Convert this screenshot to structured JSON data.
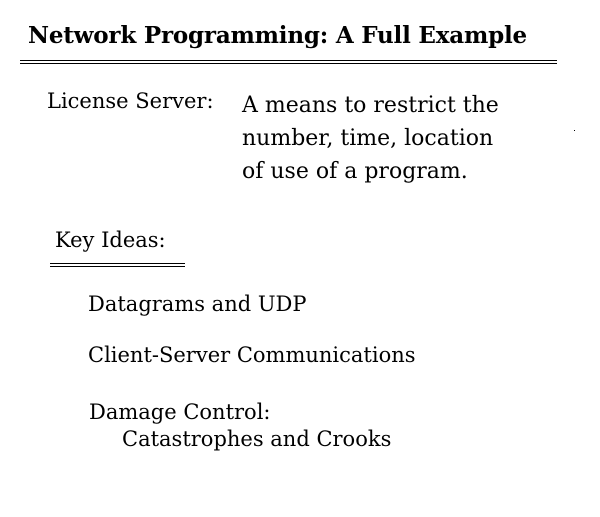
{
  "slide": {
    "title": "Network Programming: A Full Example",
    "license": {
      "label": "License Server:",
      "definition_lines": [
        "A means to restrict the",
        "number, time, location",
        "of use of a program."
      ]
    },
    "key_ideas": {
      "heading": "Key Ideas:",
      "items": [
        "Datagrams and UDP",
        "Client-Server Communications",
        "Damage Control:"
      ],
      "subitem": "Catastrophes and Crooks"
    }
  }
}
